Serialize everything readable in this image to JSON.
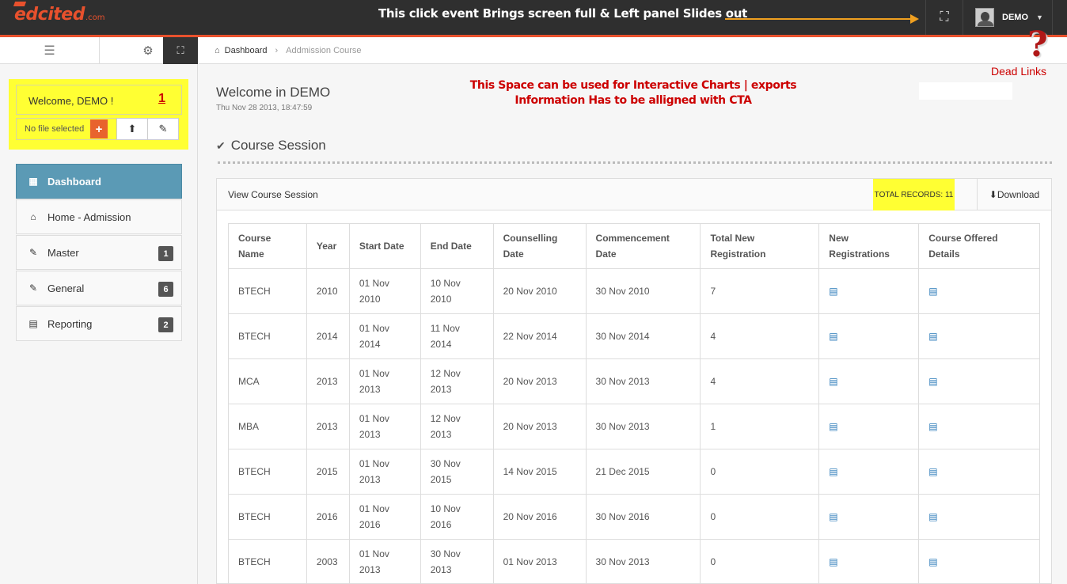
{
  "header": {
    "logo_text": "edcited",
    "logo_domain": ".com",
    "annotation": "This  click event Brings screen full &  Left panel Slides  out",
    "user_name": "DEMO"
  },
  "annotations": {
    "dead_links": "Dead Links",
    "welcome_marker": "1",
    "info_note_line1": "This Space can be used for Interactive Charts | exports",
    "info_note_line2": "Information Has to be alligned with CTA",
    "help_symbol": "?"
  },
  "sidebar": {
    "welcome": "Welcome, DEMO !",
    "file_label": "No file selected",
    "add_symbol": "+",
    "items": [
      {
        "label": "Dashboard",
        "icon": "grid-icon",
        "badge": ""
      },
      {
        "label": "Home - Admission",
        "icon": "home-icon",
        "badge": ""
      },
      {
        "label": "Master",
        "icon": "edit-icon",
        "badge": "1"
      },
      {
        "label": "General",
        "icon": "edit-icon",
        "badge": "6"
      },
      {
        "label": "Reporting",
        "icon": "book-icon",
        "badge": "2"
      }
    ]
  },
  "breadcrumb": {
    "home": "Dashboard",
    "current": "Addmission Course"
  },
  "main": {
    "title": "Welcome in DEMO",
    "date": "Thu Nov 28 2013, 18:47:59",
    "section_title": "Course Session",
    "panel_title": "View Course Session",
    "total_records": "TOTAL RECORDS: 11",
    "download": "Download"
  },
  "table": {
    "headers": [
      "Course Name",
      "Year",
      "Start Date",
      "End Date",
      "Counselling Date",
      "Commencement Date",
      "Total New Registration",
      "New Registrations",
      "Course Offered Details"
    ],
    "rows": [
      [
        "BTECH",
        "2010",
        "01 Nov 2010",
        "10 Nov 2010",
        "20 Nov 2010",
        "30 Nov 2010",
        "7"
      ],
      [
        "BTECH",
        "2014",
        "01 Nov 2014",
        "11 Nov 2014",
        "22 Nov 2014",
        "30 Nov 2014",
        "4"
      ],
      [
        "MCA",
        "2013",
        "01 Nov 2013",
        "12 Nov 2013",
        "20 Nov 2013",
        "30 Nov 2013",
        "4"
      ],
      [
        "MBA",
        "2013",
        "01 Nov 2013",
        "12 Nov 2013",
        "20 Nov 2013",
        "30 Nov 2013",
        "1"
      ],
      [
        "BTECH",
        "2015",
        "01 Nov 2013",
        "30 Nov 2015",
        "14 Nov 2015",
        "21 Dec 2015",
        "0"
      ],
      [
        "BTECH",
        "2016",
        "01 Nov 2016",
        "10 Nov 2016",
        "20 Nov 2016",
        "30 Nov 2016",
        "0"
      ],
      [
        "BTECH",
        "2003",
        "01 Nov 2013",
        "30 Nov 2013",
        "01 Nov 2013",
        "30 Nov 2013",
        "0"
      ]
    ]
  },
  "colors": {
    "accent": "#e8512d",
    "highlight": "#ffff33",
    "active_nav": "#5b9ab5",
    "annotation_red": "#cc0000"
  }
}
